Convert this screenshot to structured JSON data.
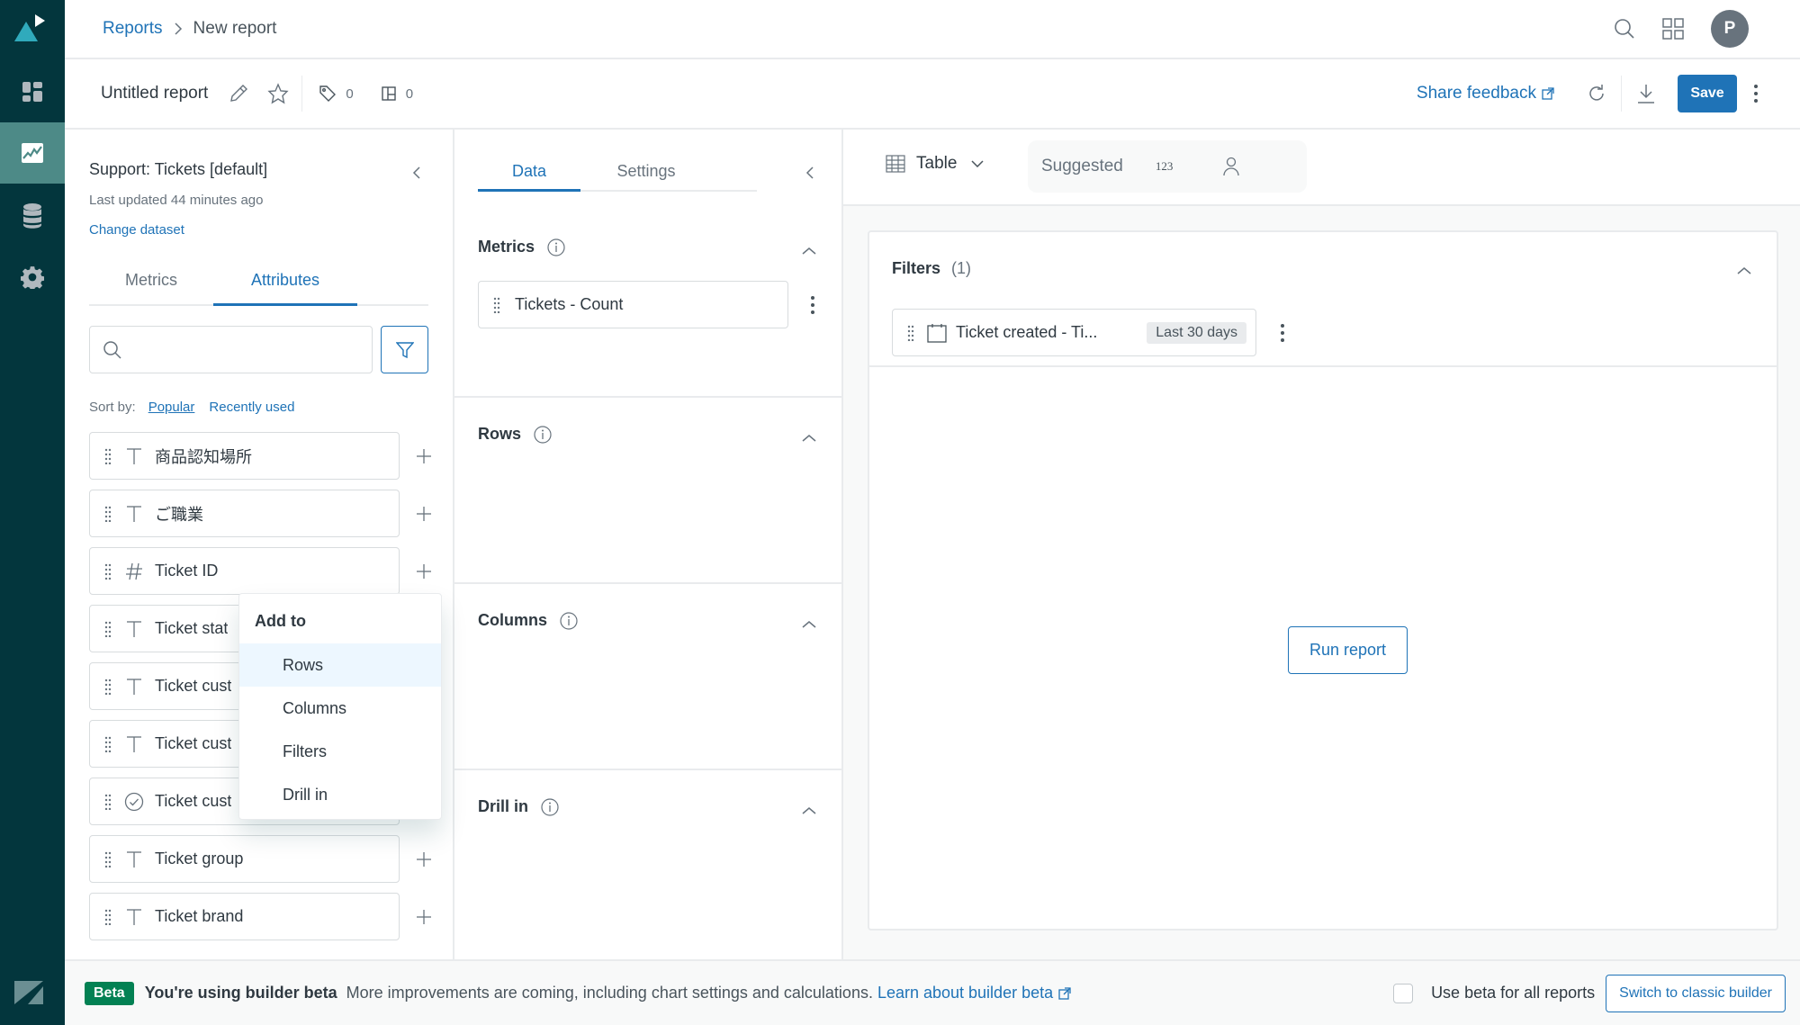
{
  "sidebar": {
    "items": [
      {
        "name": "home",
        "icon": "dashboard-icon",
        "active": false
      },
      {
        "name": "reports",
        "icon": "chart-icon",
        "active": true
      },
      {
        "name": "datasets",
        "icon": "database-icon",
        "active": false
      },
      {
        "name": "admin",
        "icon": "gear-icon",
        "active": false
      }
    ],
    "colors": {
      "bg": "#03363d",
      "active": "#4d8a87",
      "logo": "#30aabc"
    }
  },
  "breadcrumb": {
    "parent": "Reports",
    "separator": ">",
    "current": "New report"
  },
  "header": {
    "avatar_initial": "P"
  },
  "toolbar": {
    "report_title": "Untitled report",
    "tags_count": "0",
    "dashboards_count": "0",
    "share_feedback": "Share feedback",
    "save_label": "Save"
  },
  "dataset": {
    "title": "Support: Tickets [default]",
    "updated": "Last updated 44 minutes ago",
    "change_link": "Change dataset",
    "tabs": [
      {
        "label": "Metrics",
        "active": false
      },
      {
        "label": "Attributes",
        "active": true
      }
    ],
    "search_placeholder": "",
    "search_value": "",
    "sort_label": "Sort by:",
    "sort_options": [
      {
        "label": "Popular",
        "active": true
      },
      {
        "label": "Recently used",
        "active": false
      }
    ],
    "attributes": [
      {
        "label": "商品認知場所",
        "type": "text"
      },
      {
        "label": "ご職業",
        "type": "text"
      },
      {
        "label": "Ticket ID",
        "type": "number"
      },
      {
        "label": "Ticket stat",
        "type": "text"
      },
      {
        "label": "Ticket cust",
        "type": "text"
      },
      {
        "label": "Ticket cust",
        "type": "text"
      },
      {
        "label": "Ticket cust",
        "type": "checkbox"
      },
      {
        "label": "Ticket group",
        "type": "text"
      },
      {
        "label": "Ticket brand",
        "type": "text"
      }
    ]
  },
  "add_menu": {
    "header": "Add to",
    "items": [
      "Rows",
      "Columns",
      "Filters",
      "Drill in"
    ],
    "hovered": "Rows"
  },
  "builder": {
    "tabs": [
      {
        "label": "Data",
        "active": true
      },
      {
        "label": "Settings",
        "active": false
      }
    ],
    "sections": [
      {
        "title": "Metrics",
        "items": [
          "Tickets - Count"
        ]
      },
      {
        "title": "Rows",
        "items": []
      },
      {
        "title": "Columns",
        "items": []
      },
      {
        "title": "Drill in",
        "items": []
      }
    ]
  },
  "visualization": {
    "type_label": "Table",
    "suggested_label": "Suggested",
    "suggested_number_icon": "123"
  },
  "report": {
    "filters_title": "Filters",
    "filters_count": "(1)",
    "filters": [
      {
        "label": "Ticket created - Ti...",
        "value": "Last 30 days"
      }
    ],
    "run_label": "Run report"
  },
  "beta_bar": {
    "badge": "Beta",
    "title": "You're using builder beta",
    "message": "More improvements are coming, including chart settings and calculations.",
    "link": "Learn about builder beta",
    "checkbox_label": "Use beta for all reports",
    "checkbox_checked": false,
    "switch_label": "Switch to classic builder"
  },
  "colors": {
    "primary": "#1f73b7",
    "beta_green": "#038153",
    "text": "#2f3941",
    "muted": "#68737d",
    "border": "#d8dcde"
  }
}
